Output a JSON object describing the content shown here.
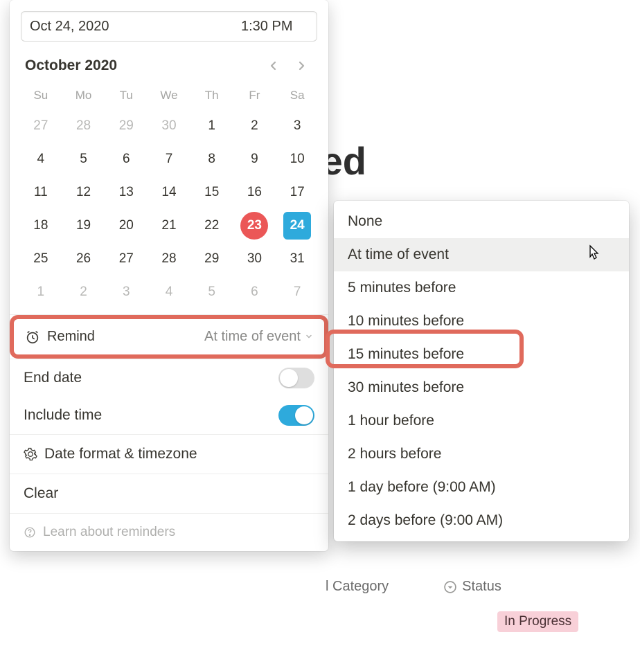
{
  "background": {
    "title_fragment": "ted",
    "category_label": "l Category",
    "status_label": "Status",
    "status_value": "In Progress"
  },
  "datepicker": {
    "date_value": "Oct 24, 2020",
    "time_value": "1:30 PM",
    "month_label": "October 2020",
    "dow": [
      "Su",
      "Mo",
      "Tu",
      "We",
      "Th",
      "Fr",
      "Sa"
    ],
    "weeks": [
      [
        {
          "n": 27,
          "other": true
        },
        {
          "n": 28,
          "other": true
        },
        {
          "n": 29,
          "other": true
        },
        {
          "n": 30,
          "other": true
        },
        {
          "n": 1
        },
        {
          "n": 2
        },
        {
          "n": 3
        }
      ],
      [
        {
          "n": 4
        },
        {
          "n": 5
        },
        {
          "n": 6
        },
        {
          "n": 7
        },
        {
          "n": 8
        },
        {
          "n": 9
        },
        {
          "n": 10
        }
      ],
      [
        {
          "n": 11
        },
        {
          "n": 12
        },
        {
          "n": 13
        },
        {
          "n": 14
        },
        {
          "n": 15
        },
        {
          "n": 16
        },
        {
          "n": 17
        }
      ],
      [
        {
          "n": 18
        },
        {
          "n": 19
        },
        {
          "n": 20
        },
        {
          "n": 21
        },
        {
          "n": 22
        },
        {
          "n": 23,
          "today": true
        },
        {
          "n": 24,
          "selected": true
        }
      ],
      [
        {
          "n": 25
        },
        {
          "n": 26
        },
        {
          "n": 27
        },
        {
          "n": 28
        },
        {
          "n": 29
        },
        {
          "n": 30
        },
        {
          "n": 31
        }
      ],
      [
        {
          "n": 1,
          "other": true
        },
        {
          "n": 2,
          "other": true
        },
        {
          "n": 3,
          "other": true
        },
        {
          "n": 4,
          "other": true
        },
        {
          "n": 5,
          "other": true
        },
        {
          "n": 6,
          "other": true
        },
        {
          "n": 7,
          "other": true
        }
      ]
    ],
    "remind_label": "Remind",
    "remind_value": "At time of event",
    "end_date_label": "End date",
    "end_date_on": false,
    "include_time_label": "Include time",
    "include_time_on": true,
    "date_format_label": "Date format & timezone",
    "clear_label": "Clear",
    "learn_label": "Learn about reminders"
  },
  "remind_menu": {
    "options": [
      {
        "label": "None"
      },
      {
        "label": "At time of event",
        "hover": true,
        "cursor": true
      },
      {
        "label": "5 minutes before"
      },
      {
        "label": "10 minutes before"
      },
      {
        "label": "15 minutes before",
        "highlight": true
      },
      {
        "label": "30 minutes before"
      },
      {
        "label": "1 hour before"
      },
      {
        "label": "2 hours before"
      },
      {
        "label": "1 day before (9:00 AM)"
      },
      {
        "label": "2 days before (9:00 AM)"
      }
    ]
  }
}
